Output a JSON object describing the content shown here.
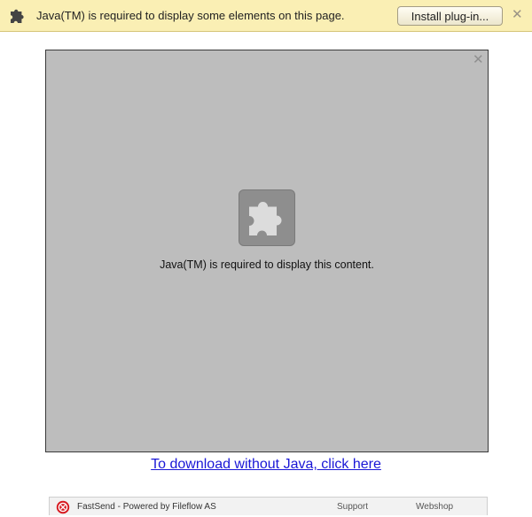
{
  "infobar": {
    "icon": "puzzle-piece-icon",
    "message": "Java(TM) is required to display some elements on this page.",
    "install_label": "Install plug-in...",
    "close_glyph": "✕"
  },
  "plugin": {
    "icon": "puzzle-piece-icon",
    "message": "Java(TM) is required to display this content.",
    "close_glyph": "✕"
  },
  "download_link": "To download without Java, click here",
  "footer": {
    "logo_icon": "fastsend-logo-icon",
    "brand": "FastSend - Powered by Fileflow AS",
    "support": "Support",
    "webshop": "Webshop"
  },
  "colors": {
    "infobar_bg": "#faefb4",
    "plugin_bg": "#bdbdbd",
    "link": "#1a17d6"
  }
}
